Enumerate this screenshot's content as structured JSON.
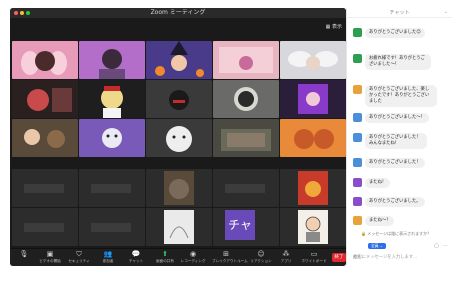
{
  "meeting": {
    "title": "Zoom ミーティング",
    "view_label": "表示",
    "end_label": "終了"
  },
  "toolbar": {
    "items": [
      {
        "icon": "mic-muted-icon",
        "label": ""
      },
      {
        "icon": "video-muted-icon",
        "label": "ビデオの開始"
      },
      {
        "icon": "shield-icon",
        "label": "セキュリティ"
      },
      {
        "icon": "participants-icon",
        "label": "参加者"
      },
      {
        "icon": "chat-icon",
        "label": "チャット"
      },
      {
        "icon": "share-screen-icon",
        "label": "画面の共有"
      },
      {
        "icon": "record-icon",
        "label": "レコーディング"
      },
      {
        "icon": "breakout-rooms-icon",
        "label": "ブレイクアウトルーム"
      },
      {
        "icon": "reactions-icon",
        "label": "リアクション"
      },
      {
        "icon": "apps-icon",
        "label": "アプリ"
      },
      {
        "icon": "whiteboard-icon",
        "label": "ホワイトボード"
      }
    ]
  },
  "chat": {
    "title": "チャット",
    "messages": [
      {
        "avatar": "",
        "color": "#2e9e4f",
        "text": "ありがとうございました😊"
      },
      {
        "avatar": "",
        "color": "#2e9e4f",
        "text": "お疲れ様です！ありがとうございました〜！"
      },
      {
        "avatar": "",
        "color": "#e8a23a",
        "text": "ありがとうございました、楽しかったです！ありがとうございました"
      },
      {
        "avatar": "",
        "color": "#4a8fd8",
        "text": "ありがとうございました〜！"
      },
      {
        "avatar": "",
        "color": "#4a8fd8",
        "text": "ありがとうございました！みんなまたね！"
      },
      {
        "avatar": "",
        "color": "#4a8fd8",
        "text": "ありがとうございました！"
      },
      {
        "avatar": "",
        "color": "#8a4cc8",
        "text": "またね！"
      },
      {
        "avatar": "",
        "color": "#8a4cc8",
        "text": "ありがとうございました。"
      },
      {
        "avatar": "",
        "color": "#e8a23a",
        "text": "またね〜！"
      }
    ],
    "notice": "メッセージは誰に表示されますか？",
    "to_label": "宛先:",
    "to_value": "全員",
    "input_placeholder": "ここにメッセージを入力します…"
  },
  "tiles": {
    "cha_text": "チャ"
  }
}
